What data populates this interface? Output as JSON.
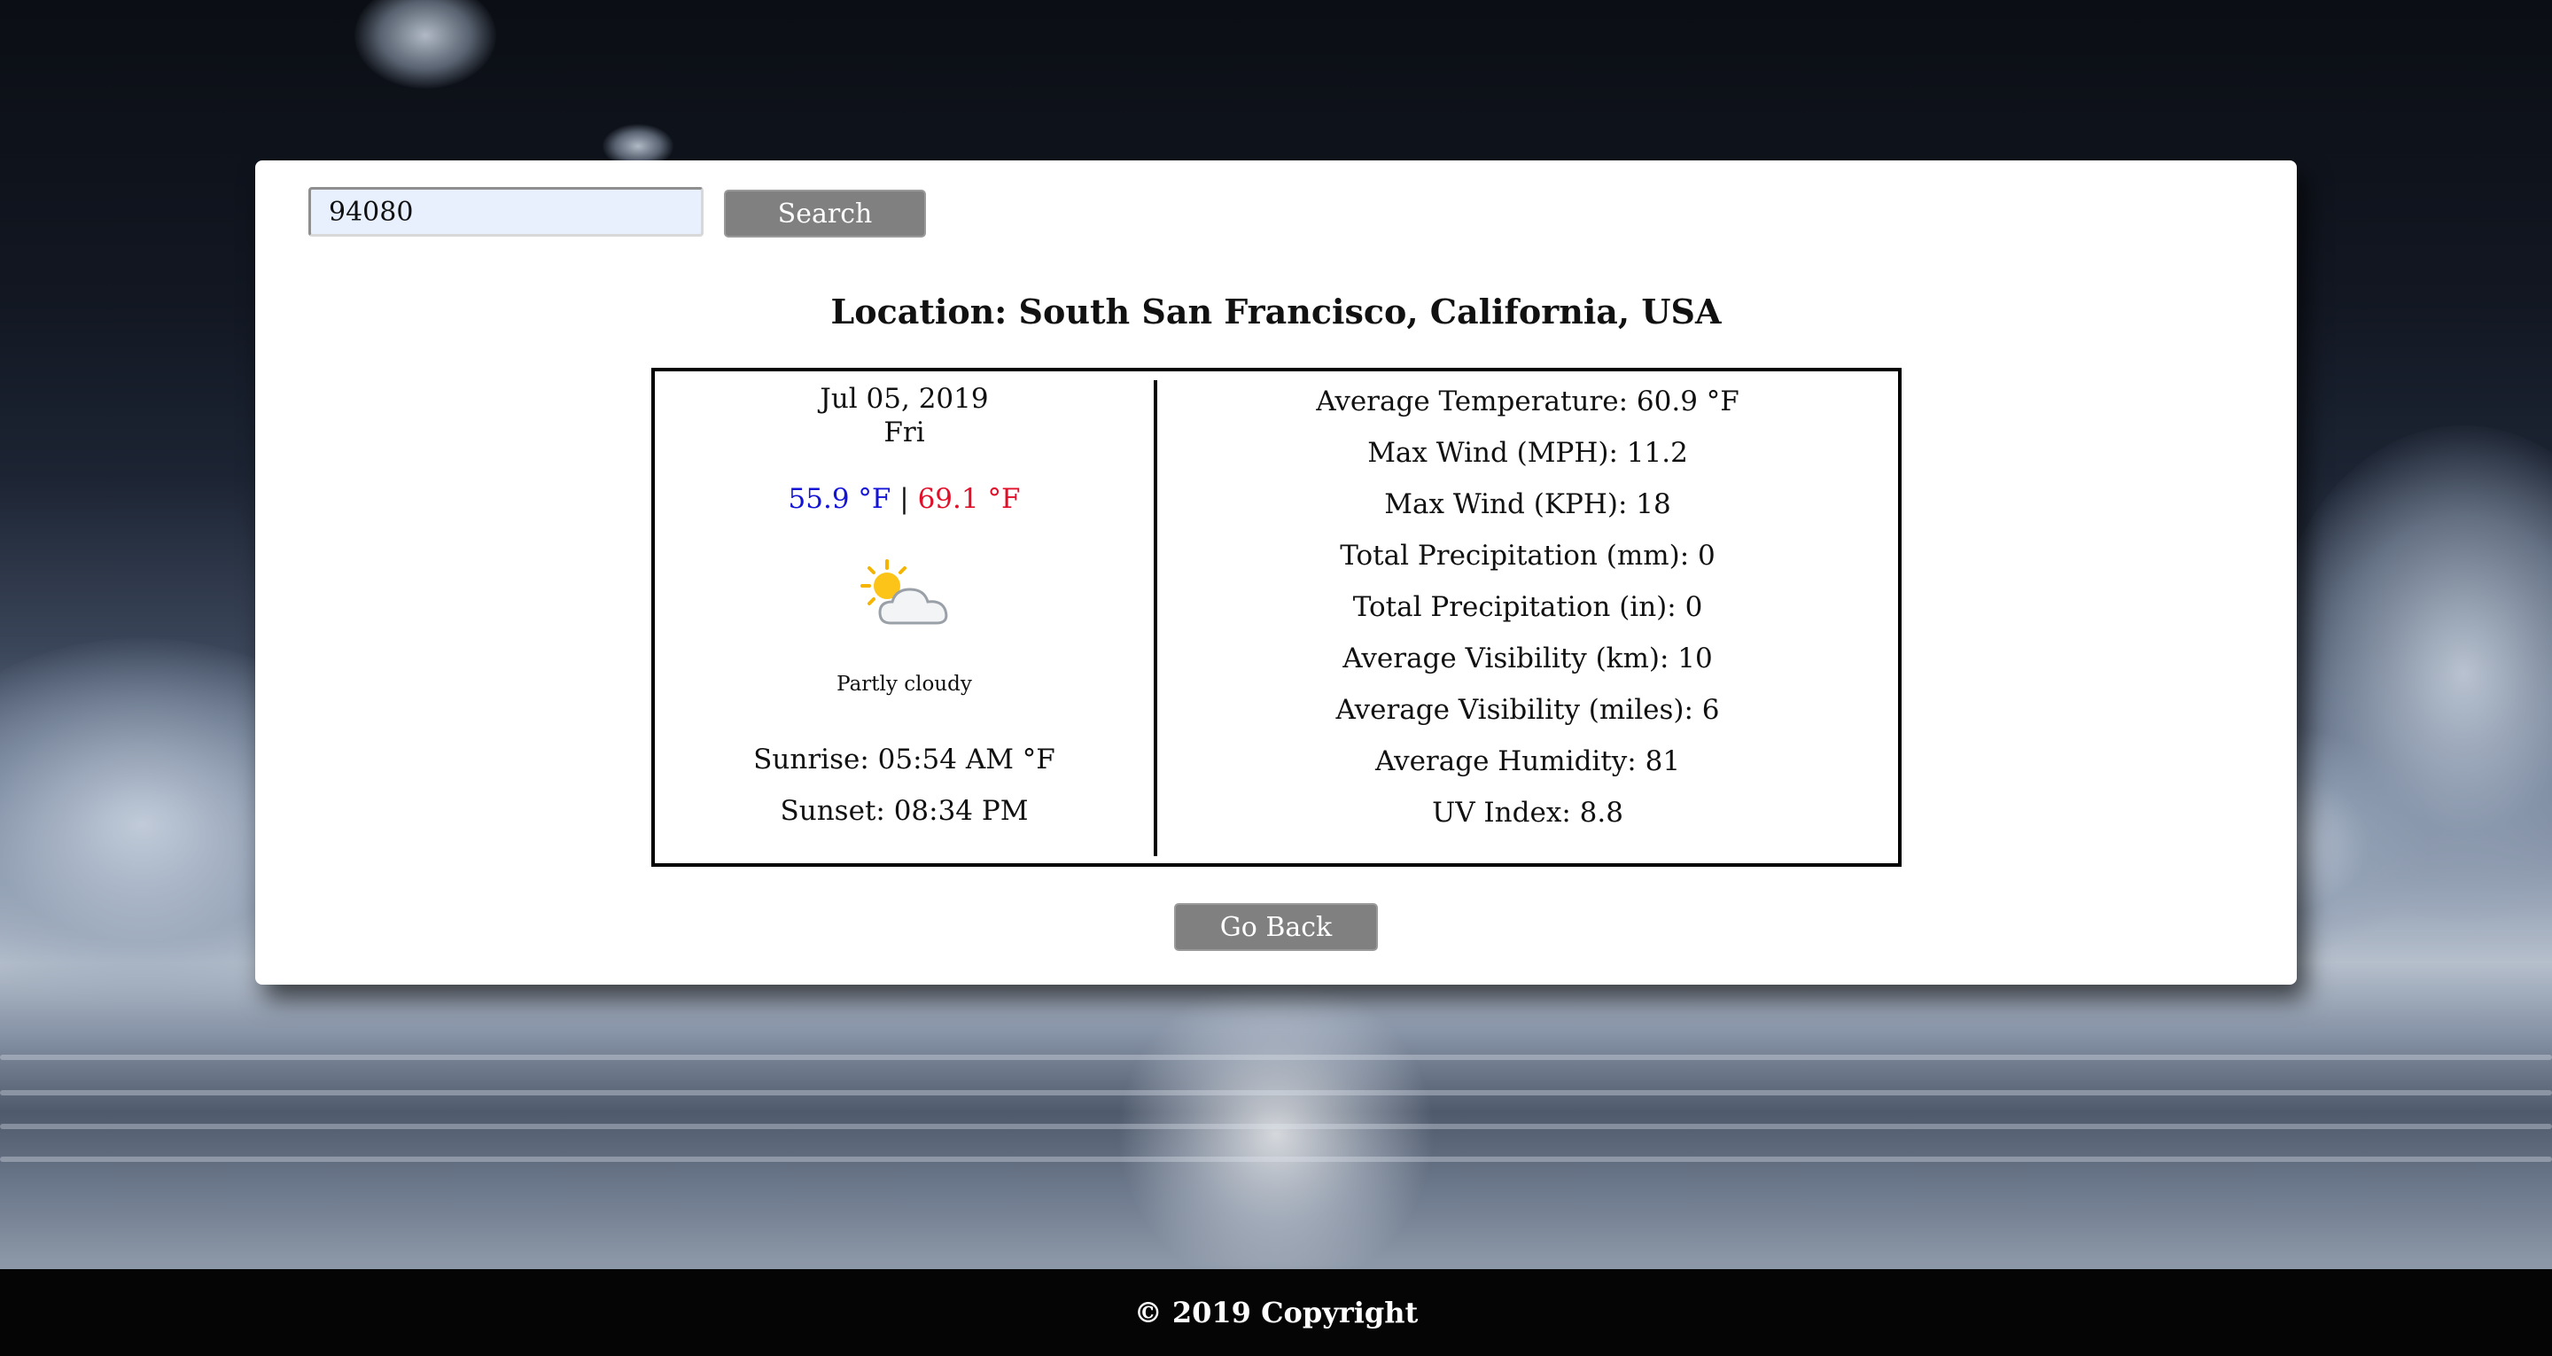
{
  "search": {
    "value": "94080",
    "button_label": "Search"
  },
  "location": {
    "title": "Location: South San Francisco, California, USA"
  },
  "forecast": {
    "date": "Jul 05, 2019",
    "weekday": "Fri",
    "min_temp": "55.9 °F",
    "separator": "|",
    "max_temp": "69.1 °F",
    "icon": "partly-cloudy-icon",
    "condition": "Partly cloudy",
    "sunrise": "Sunrise: 05:54 AM °F",
    "sunset": "Sunset: 08:34 PM"
  },
  "stats": [
    "Average Temperature: 60.9 °F",
    "Max Wind (MPH): 11.2",
    "Max Wind (KPH): 18",
    "Total Precipitation (mm): 0",
    "Total Precipitation (in): 0",
    "Average Visibility (km): 10",
    "Average Visibility (miles): 6",
    "Average Humidity: 81",
    "UV Index: 8.8"
  ],
  "actions": {
    "go_back_label": "Go Back"
  },
  "footer": {
    "text": "© 2019 Copyright"
  },
  "colors": {
    "min_temp": "#1414d6",
    "max_temp": "#e0102a",
    "button_bg": "#808080",
    "input_bg": "#e8f0fe",
    "footer_bg": "#050505"
  }
}
